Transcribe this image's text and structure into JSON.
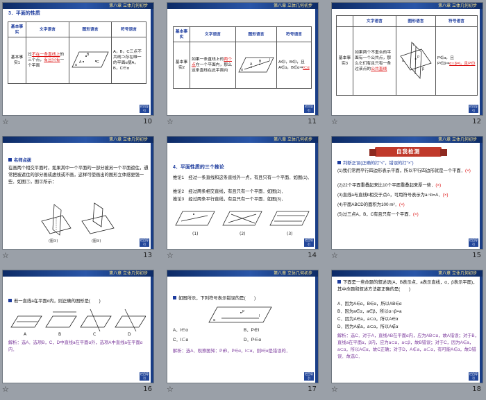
{
  "band_tag": "第八章  立体几何初步",
  "nav_label": "栏目导引",
  "footer_star": "☆",
  "slides": [
    {
      "page": "10",
      "heading": "3．平面的性质",
      "headers": [
        "基本事实",
        "文字语言",
        "图形语言",
        "符号语言"
      ],
      "row_name": "基本事实1",
      "text_a": "过",
      "text_b": "不在一条直线上",
      "text_c": "的三个点，",
      "text_d": "有且只有",
      "text_e": "一个平面",
      "fig_a": "A",
      "fig_b": "B",
      "fig_c": "C",
      "fig_alpha": "α",
      "symbolic": "A，B，C三点不共线⇒存在唯一的平面α使A，B，C∈α"
    },
    {
      "page": "11",
      "headers": [
        "基本事实",
        "文字语言",
        "图形语言",
        "符号语言"
      ],
      "row_name": "基本事实2",
      "text_a": "如果一条直线上的",
      "text_b": "两个点",
      "text_c": "在一个平面内，那么这条直线在此平面内",
      "fig_a": "A",
      "fig_b": "B",
      "fig_l": "l",
      "fig_alpha": "α",
      "sym_a": "A∈l，B∈l，且A∈α，B∈α⇒",
      "sym_b": "l⊂α"
    },
    {
      "page": "12",
      "headers": [
        "文字语言",
        "图形语言",
        "符号语言"
      ],
      "row_name": "基本事实3",
      "text_a": "如果两个不重合的平面有一个公共点，那么它们有且只有一条过该点的",
      "text_b": "公共直线",
      "fig_p": "P",
      "fig_l": "l",
      "fig_alpha": "α",
      "fig_beta": "β",
      "sym_a": "P∈α，且P∈β⇒",
      "sym_b": "α∩β=l，且P∈l"
    },
    {
      "page": "13",
      "heading": "名师点拨",
      "body": "在画两个相交平面时，如果其中一个平面的一部分被另一个平面遮住，通常把被遮住的部分画成虚线或不画，这样可使画出的图形立体感更强一些．如图①，图②所示：",
      "cap1": "(图①)",
      "cap2": "(图②)"
    },
    {
      "page": "14",
      "heading": "4．平面性质的三个推论",
      "lines": [
        "推论1　经过一条直线和这条直线外一点，有且只有一个平面．如图(1)．",
        "推论2　经过两条相交直线，有且只有一个平面．如图(2)．",
        "推论3　经过两条平行直线，有且只有一个平面．如图(3)．"
      ],
      "caps": [
        "(1)",
        "(2)",
        "(3)"
      ]
    },
    {
      "page": "15",
      "ribbon": "自我检测",
      "intro": "判断正误(正确的打“√”，错误的打“×”)",
      "items": [
        {
          "q": "(1)我们常用平行四边形表示平面，所以平行四边形就是一个平面．",
          "a": "(×)"
        },
        {
          "q": "(2)22个平面重叠起来比10个平面重叠起来厚一些．",
          "a": "(×)"
        },
        {
          "q": "(3)直线a与直线b相交于点A，可用符号表示为a∩b=A．",
          "a": "(×)"
        },
        {
          "q": "(4)平面ABCD的面积为100 m²．",
          "a": "(×)"
        },
        {
          "q": "(5)过三点A，B，C有且只有一个平面．",
          "a": "(×)"
        }
      ]
    },
    {
      "page": "16",
      "question": "若一直线a在平面α内，则正确的图形是(　　)",
      "labels": [
        "A",
        "B",
        "C",
        "D"
      ],
      "answer": "解析：选A．选项B，C，D中直线a在平面α外，选项A中直线a在平面α内．"
    },
    {
      "page": "17",
      "question": "如图所示，下列符号表示错误的是(　　)",
      "options": [
        "A．l∈α",
        "B．P∉l",
        "C．l⊂α",
        "D．P∈α"
      ],
      "fig_p": "P",
      "fig_l": "l",
      "fig_alpha": "α",
      "answer": "解析：选A．观察图知：P∉l，P∈α，l⊂α，则l∈α是错误的．"
    },
    {
      "page": "18",
      "question": "下面是一些命题的叙述语(A，B表示点，a表示直线，α，β表示平面)，其中命题和叙述方法都正确的是(　　)",
      "options": [
        "A．因为A∈α，B∈α，所以AB∈α",
        "B．因为a∈α，a∈β，所以α∩β=a",
        "C．因为A∈a，a⊂α，所以A∈α",
        "D．因为A∉a，a⊂α，所以A∉α"
      ],
      "answer": "解析：选C．对于A，直线AB在平面α内，应为AB⊂α，故A错误；对于B，直线a在平面α，β内，应为a⊂α，a⊂β，故B错误；对于C，因为A∈a，a⊂α，所以A∈α，故C正确；对于D，A∉a，a⊂α，有可能A∈α，故D错误．故选C．"
    }
  ]
}
